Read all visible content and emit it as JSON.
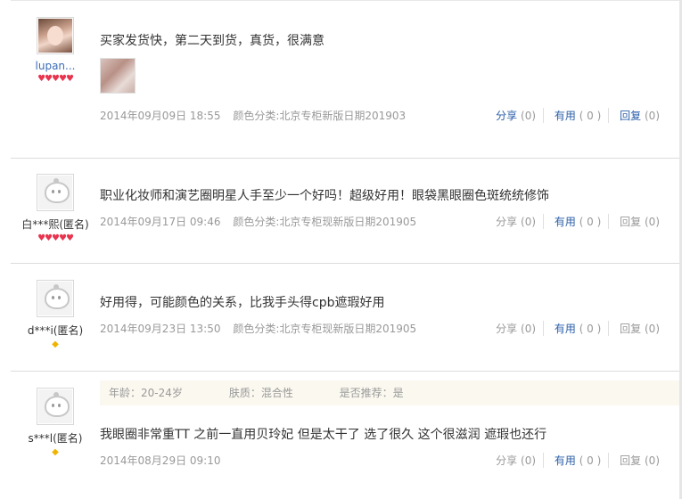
{
  "reviews": [
    {
      "username": "lupan...",
      "level": "♥♥♥♥♥",
      "text": "买家发货快，第二天到货，真货，很满意",
      "date": "2014年09月09日 18:55",
      "variant": "颜色分类:北京专柜新版日期201903",
      "share_label": "分享",
      "share_count": "(0)",
      "useful_label": "有用",
      "useful_count": "( 0 )",
      "reply_label": "回复",
      "reply_count": "(0)"
    },
    {
      "username": "白***熙(匿名)",
      "level": "♥♥♥♥♥",
      "text": "职业化妆师和演艺圈明星人手至少一个好吗！超级好用！眼袋黑眼圈色斑统统修饰",
      "date": "2014年09月17日 09:46",
      "variant": "颜色分类:北京专柜现新版日期201905",
      "share_label": "分享",
      "share_count": "(0)",
      "useful_label": "有用",
      "useful_count": "( 0 )",
      "reply_label": "回复",
      "reply_count": "(0)"
    },
    {
      "username": "d***i(匿名)",
      "level": "◆",
      "text": "好用得，可能颜色的关系，比我手头得cpb遮瑕好用",
      "date": "2014年09月23日 13:50",
      "variant": "颜色分类:北京专柜现新版日期201905",
      "share_label": "分享",
      "share_count": "(0)",
      "useful_label": "有用",
      "useful_count": "( 0 )",
      "reply_label": "回复",
      "reply_count": "(0)"
    },
    {
      "username": "s***l(匿名)",
      "level": "◆",
      "age": "年龄：20-24岁",
      "skin": "肤质：混合性",
      "recommend": "是否推荐：是",
      "text": "我眼圈非常重TT 之前一直用贝玲妃 但是太干了 选了很久 这个很滋润 遮瑕也还行",
      "date": "2014年08月29日 09:10",
      "share_label": "分享",
      "share_count": "(0)",
      "useful_label": "有用",
      "useful_count": "( 0 )",
      "reply_label": "回复",
      "reply_count": "(0)"
    }
  ]
}
